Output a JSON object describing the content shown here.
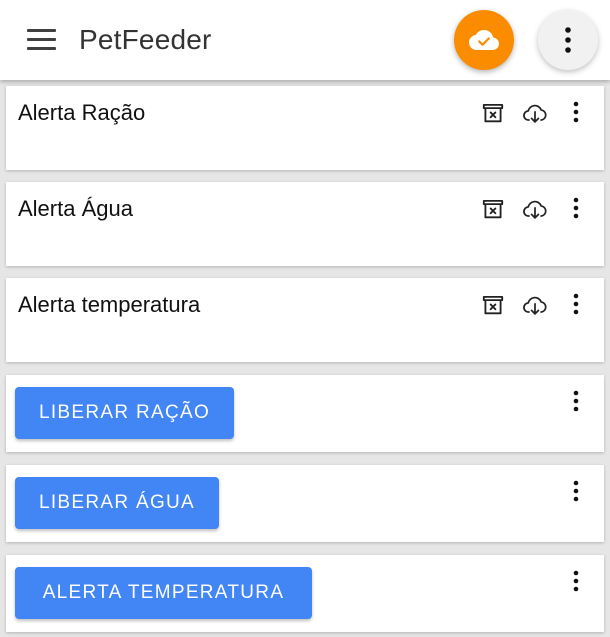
{
  "appbar": {
    "title": "PetFeeder",
    "menu_icon": "hamburger-menu-icon",
    "cloud_button_icon": "cloud-check-icon",
    "more_icon": "more-vert-icon",
    "cloud_button_color": "#fb8c00"
  },
  "alerts": [
    {
      "title": "Alerta Ração",
      "icons": [
        "archive-delete-icon",
        "cloud-download-icon",
        "more-vert-icon"
      ]
    },
    {
      "title": "Alerta Água",
      "icons": [
        "archive-delete-icon",
        "cloud-download-icon",
        "more-vert-icon"
      ]
    },
    {
      "title": "Alerta temperatura",
      "icons": [
        "archive-delete-icon",
        "cloud-download-icon",
        "more-vert-icon"
      ]
    }
  ],
  "actions": [
    {
      "label": "LIBERAR RAÇÃO",
      "icon": "more-vert-icon"
    },
    {
      "label": "LIBERAR ÁGUA",
      "icon": "more-vert-icon"
    },
    {
      "label": "ALERTA TEMPERATURA",
      "icon": "more-vert-icon"
    }
  ],
  "colors": {
    "accent_button": "#4285f4",
    "background": "#e6e6e6",
    "card": "#ffffff"
  }
}
